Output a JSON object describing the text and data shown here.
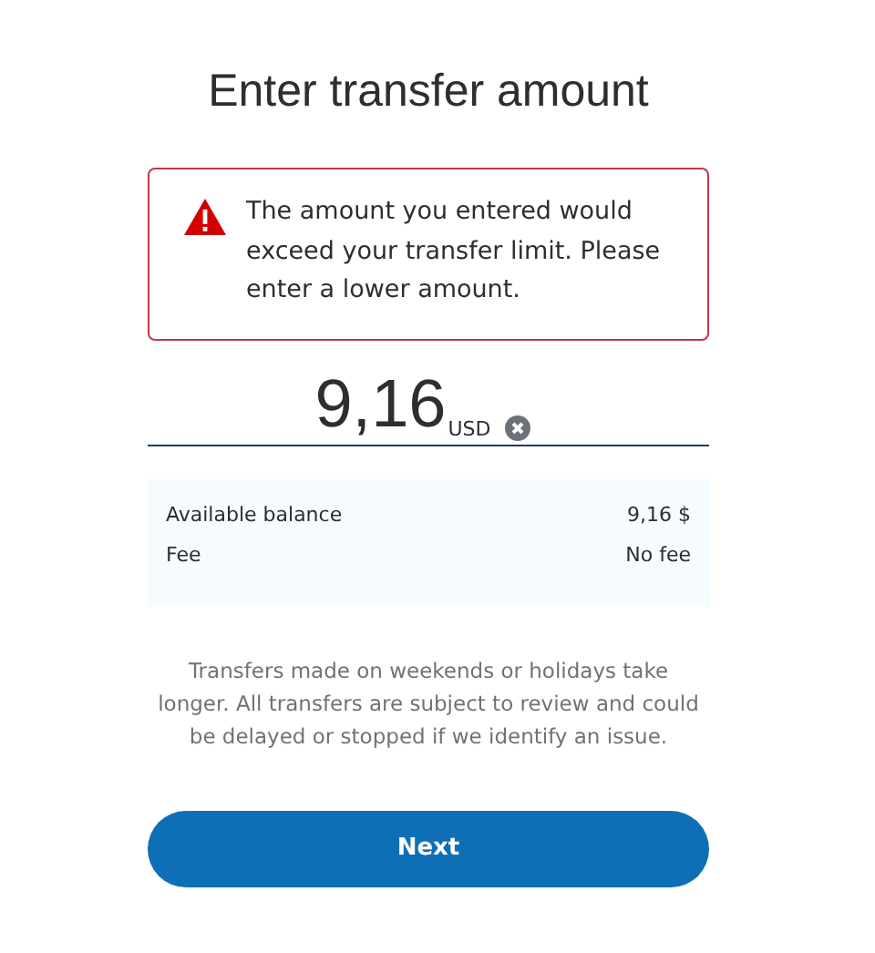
{
  "title": "Enter transfer amount",
  "alert": {
    "message": "The amount you entered would exceed your transfer limit. Please enter a lower amount."
  },
  "amount": {
    "value": "9,16",
    "currency": "USD"
  },
  "details": [
    {
      "label": "Available balance",
      "value": "9,16 $"
    },
    {
      "label": "Fee",
      "value": "No fee"
    }
  ],
  "note": "Transfers made on weekends or holidays take longer. All transfers are subject to review and could be delayed or stopped if we identify an issue.",
  "next_button": "Next"
}
